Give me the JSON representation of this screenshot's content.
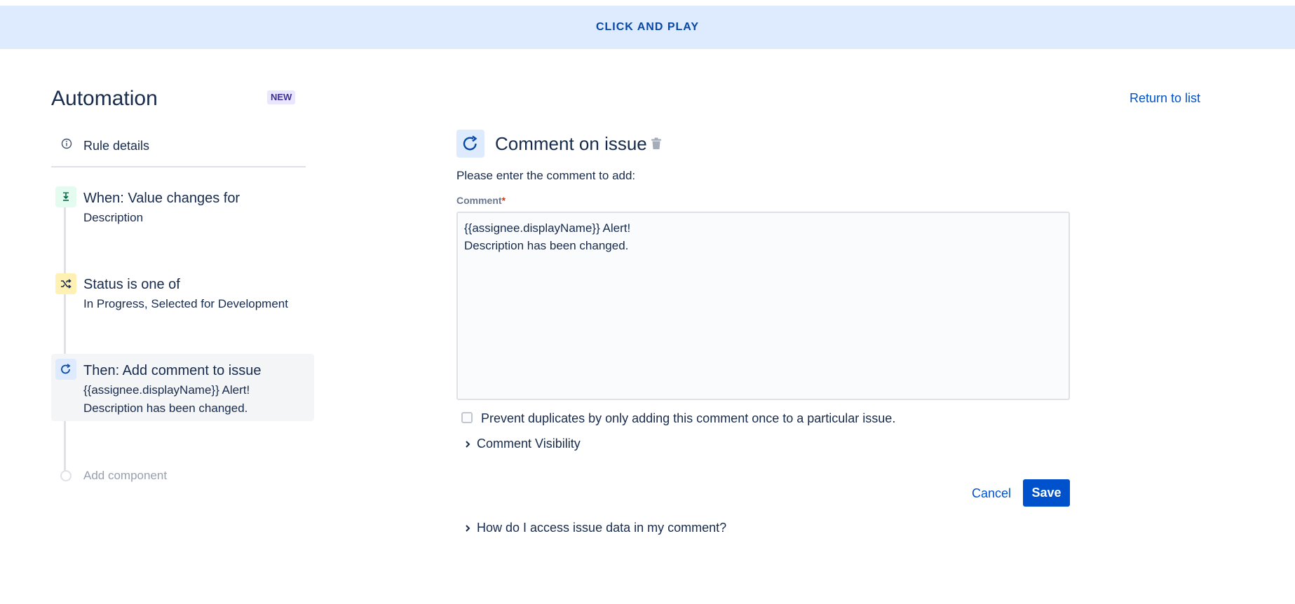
{
  "banner": {
    "text": "CLICK AND PLAY"
  },
  "header": {
    "title": "Automation",
    "badge": "NEW",
    "return_link": "Return to list"
  },
  "sidebar": {
    "rule_details": {
      "label": "Rule details",
      "icon": "info-icon"
    },
    "steps": [
      {
        "title": "When: Value changes for",
        "subtitle": "Description",
        "icon": "field-change-icon",
        "color": "#e3fcef"
      },
      {
        "title": "Status is one of",
        "subtitle": "In Progress, Selected for Development",
        "icon": "shuffle-icon",
        "color": "#fff0b3"
      },
      {
        "title": "Then: Add comment to issue",
        "subtitle": "{{assignee.displayName}} Alert!\nDescription has been changed.",
        "icon": "comment-refresh-icon",
        "color": "#deebff",
        "selected": true
      }
    ],
    "add_component": "Add component"
  },
  "panel": {
    "title": "Comment on issue",
    "instruction": "Please enter the comment to add:",
    "field_label": "Comment",
    "required_marker": "*",
    "comment_value": "{{assignee.displayName}} Alert!\nDescription has been changed.",
    "prevent_duplicates": {
      "label": "Prevent duplicates by only adding this comment once to a particular issue.",
      "checked": false
    },
    "visibility_toggle": "Comment Visibility",
    "cancel_label": "Cancel",
    "save_label": "Save",
    "help_toggle": "How do I access issue data in my comment?"
  },
  "colors": {
    "accent": "#0052cc",
    "banner_bg": "#deebff",
    "banner_text": "#0747a6"
  }
}
